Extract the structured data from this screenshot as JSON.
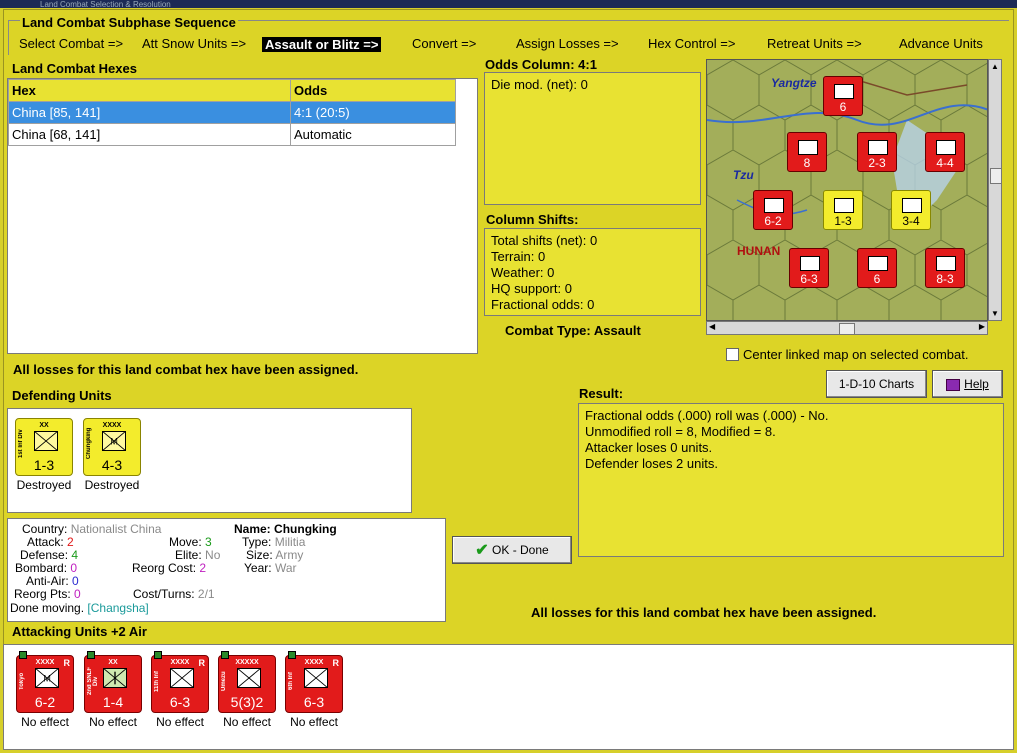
{
  "window": {
    "title": "Land Combat Selection & Resolution"
  },
  "sequence": {
    "title": "Land Combat Subphase Sequence",
    "steps": [
      "Select Combat =>",
      "Att Snow Units =>",
      "Assault or Blitz =>",
      "Convert =>",
      "Assign Losses =>",
      "Hex Control =>",
      "Retreat Units =>",
      "Advance Units"
    ]
  },
  "hexes": {
    "title": "Land Combat Hexes",
    "headers": [
      "Hex",
      "Odds"
    ],
    "rows": [
      {
        "hex": "China [85, 141]",
        "odds": "4:1 (20:5)"
      },
      {
        "hex": "China [68, 141]",
        "odds": "Automatic"
      }
    ]
  },
  "odds": {
    "title": "Odds Column: 4:1",
    "die_mod": "Die mod. (net): 0"
  },
  "shifts": {
    "title": "Column Shifts:",
    "lines": [
      "Total shifts (net): 0",
      "Terrain: 0",
      "Weather: 0",
      "HQ support: 0",
      "Fractional odds: 0"
    ]
  },
  "combat_type": {
    "label": "Combat Type:",
    "value": "Assault"
  },
  "map": {
    "labels": [
      "Yangtze",
      "Tzu",
      "HUNAN"
    ],
    "center_checkbox_label": "Center linked map on selected combat.",
    "counters": [
      {
        "strength": "6",
        "style": "red"
      },
      {
        "strength": "8",
        "style": "red"
      },
      {
        "strength": "2-3",
        "style": "red"
      },
      {
        "strength": "4-4",
        "style": "red"
      },
      {
        "strength": "6-2",
        "style": "red"
      },
      {
        "strength": "1-3",
        "style": "yellow"
      },
      {
        "strength": "3-4",
        "style": "yellow"
      },
      {
        "strength": "6-3",
        "style": "red"
      },
      {
        "strength": "6",
        "style": "red"
      },
      {
        "strength": "8-3",
        "style": "red"
      }
    ]
  },
  "buttons": {
    "charts": "1-D-10 Charts",
    "help": "Help",
    "ok": "OK - Done"
  },
  "losses_msg": "All losses for this land combat hex have been assigned.",
  "defending": {
    "title": "Defending Units",
    "units": [
      {
        "size": "XX",
        "name": "1st Inf Div",
        "strength": "1-3",
        "status": "Destroyed"
      },
      {
        "size": "XXXX",
        "name": "Chungking",
        "strength": "4-3",
        "status": "Destroyed"
      }
    ]
  },
  "result": {
    "title": "Result:",
    "lines": [
      "Fractional odds (.000) roll was (.000)  - No.",
      "Unmodified roll = 8, Modified = 8.",
      "Attacker loses 0 units.",
      "Defender loses 2 units."
    ]
  },
  "info": {
    "country_label": "Country:",
    "country": "Nationalist China",
    "attack_label": "Attack:",
    "attack": "2",
    "defense_label": "Defense:",
    "defense": "4",
    "bombard_label": "Bombard:",
    "bombard": "0",
    "antiair_label": "Anti-Air:",
    "antiair": "0",
    "reorg_label": "Reorg Pts:",
    "reorg": "0",
    "done_moving": "Done moving.",
    "location": "[Changsha]",
    "move_label": "Move:",
    "move": "3",
    "elite_label": "Elite:",
    "elite": "No",
    "reorg_cost_label": "Reorg Cost:",
    "reorg_cost": "2",
    "cost_turns_label": "Cost/Turns:",
    "cost_turns": "2/1",
    "name_label": "Name:",
    "name": "Chungking",
    "type_label": "Type:",
    "type": "Militia",
    "size_label": "Size:",
    "size": "Army",
    "year_label": "Year:",
    "year": "War"
  },
  "attacking": {
    "title": "Attacking Units +2 Air",
    "units": [
      {
        "size": "XXXX",
        "name": "Tokyo",
        "strength": "6-2",
        "status": "No effect",
        "symbol": "M"
      },
      {
        "size": "XX",
        "name": "2nd SNLF Div",
        "strength": "1-4",
        "status": "No effect",
        "symbol": "anchor"
      },
      {
        "size": "XXXX",
        "name": "11th Inf",
        "strength": "6-3",
        "status": "No effect",
        "symbol": "X"
      },
      {
        "size": "XXXXX",
        "name": "Umezu",
        "strength": "5(3)2",
        "status": "No effect",
        "symbol": "X"
      },
      {
        "size": "XXXX",
        "name": "6th Inf",
        "strength": "6-3",
        "status": "No effect",
        "symbol": "X"
      }
    ]
  },
  "colors": {
    "background": "#d6cf2a",
    "selection": "#3a8fe0",
    "counter_red": "#e21b1b",
    "counter_yellow": "#f3ec2c"
  }
}
